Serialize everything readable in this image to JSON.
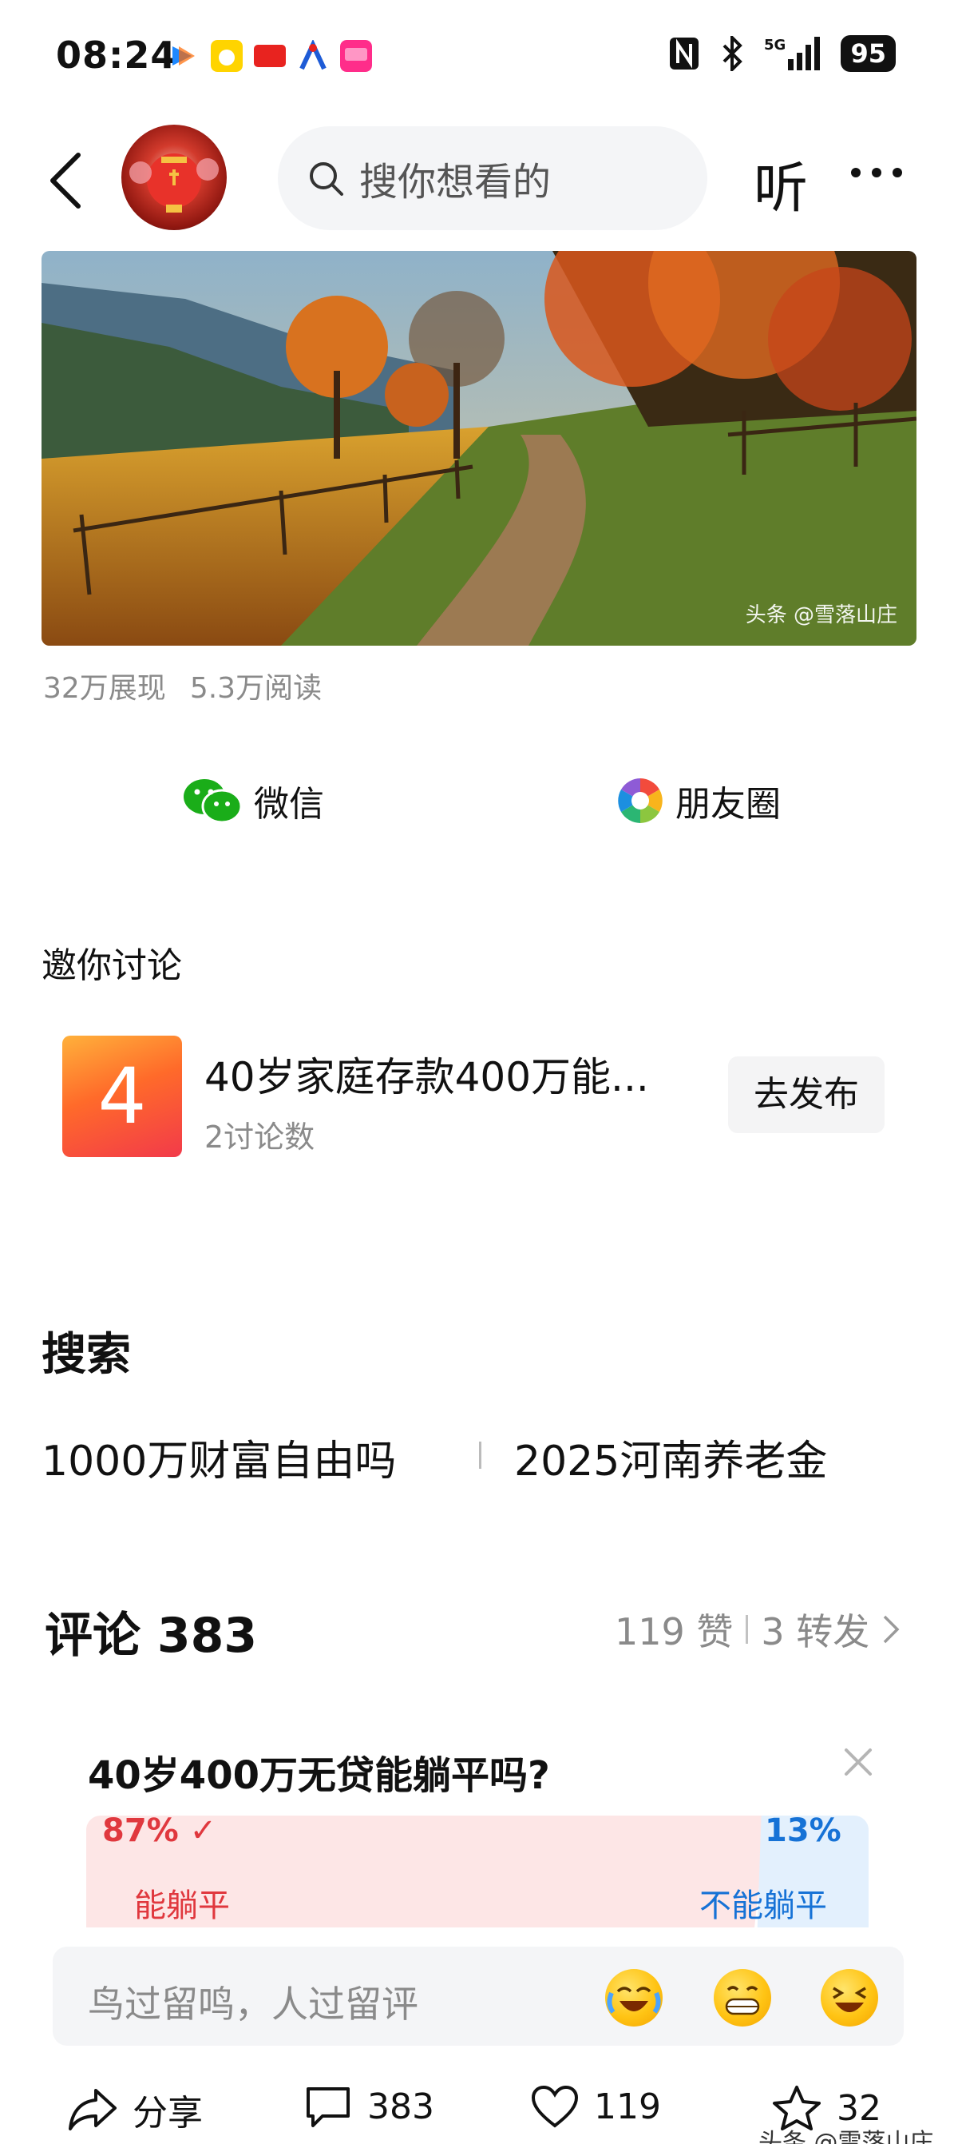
{
  "status_bar": {
    "time": "08:24",
    "network": "5G",
    "battery": "95",
    "icons": [
      "app-notification-icon",
      "nfc-icon",
      "bluetooth-icon",
      "signal-icon",
      "battery-icon"
    ]
  },
  "nav": {
    "search_placeholder": "搜你想看的",
    "listen_label": "听",
    "icons": [
      "back-icon",
      "search-icon",
      "more-icon"
    ]
  },
  "article": {
    "image_watermark": "头条 @雪落山庄",
    "impressions": "32万展现",
    "reads": "5.3万阅读"
  },
  "share": {
    "wechat_label": "微信",
    "moments_label": "朋友圈"
  },
  "discussion": {
    "title": "邀你讨论",
    "topic": {
      "badge": "4",
      "title": "40岁家庭存款400万能...",
      "subtitle": "2讨论数",
      "button": "去发布"
    }
  },
  "search": {
    "title": "搜索",
    "suggestions": [
      "1000万财富自由吗",
      "2025河南养老金"
    ]
  },
  "comments": {
    "title": "评论 383",
    "likes": "119 赞",
    "reposts": "3 转发"
  },
  "poll": {
    "question": "40岁400万无贷能躺平吗?",
    "yes_percent": "87% ✓",
    "yes_label": "能躺平",
    "no_percent": "13%",
    "no_label": "不能躺平",
    "yes_share": 0.87,
    "no_share": 0.13
  },
  "comment_input": {
    "placeholder": "鸟过留鸣，人过留评"
  },
  "actions": {
    "share": "分享",
    "comments": "383",
    "likes": "119",
    "favorites": "32"
  },
  "footer_watermark": "头条 @雪落山庄",
  "colors": {
    "yes": "#e0383e",
    "no": "#1672d6",
    "wechat": "#1aad19"
  }
}
